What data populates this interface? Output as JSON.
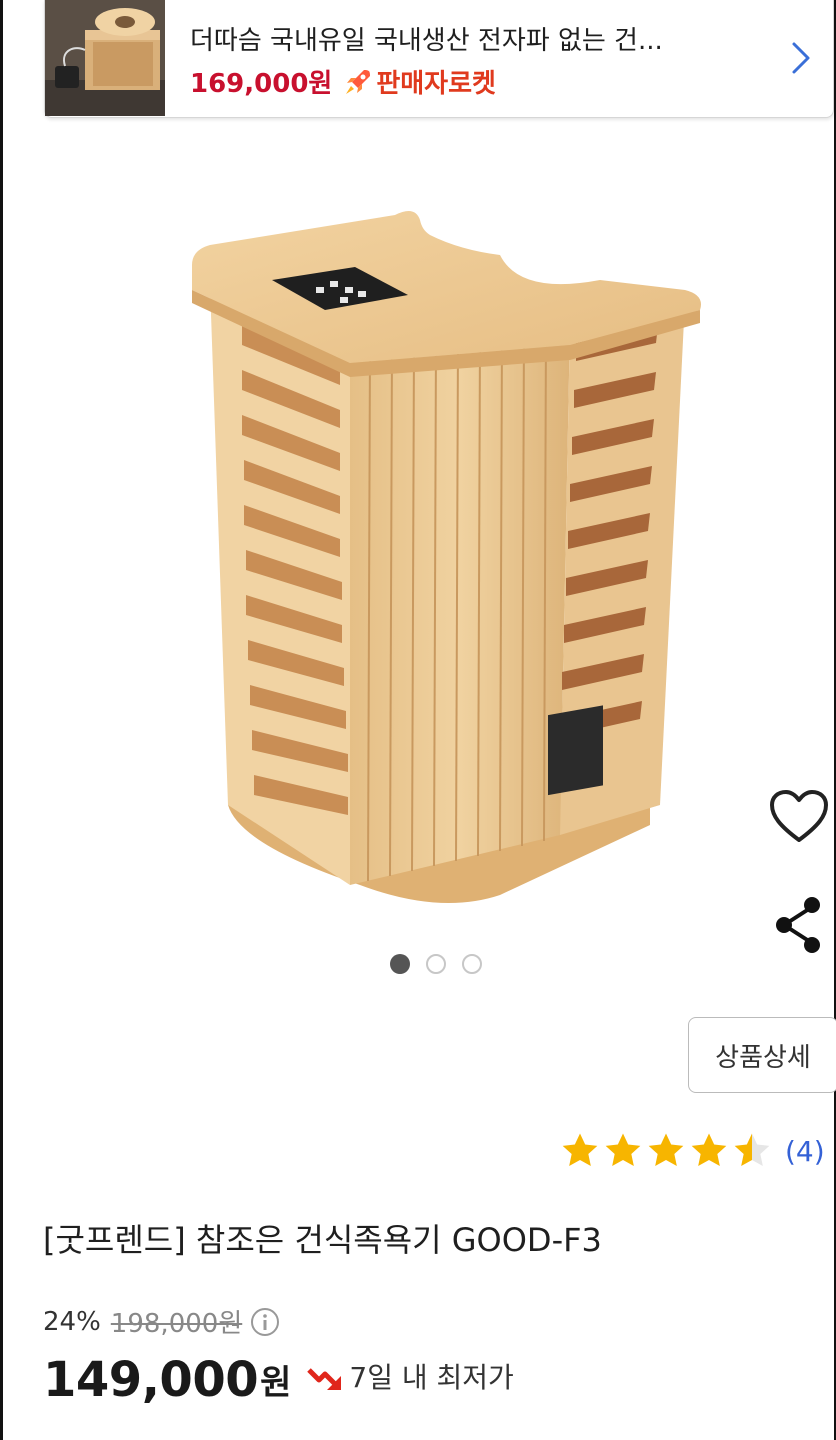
{
  "banner": {
    "title": "더따슴 국내유일 국내생산 전자파 없는 건...",
    "price": "169,000원",
    "badge_label": "판매자로켓",
    "badge_icon": "rocket-icon",
    "thumbnail_desc_icon": "foot-sauma-thumbnail"
  },
  "gallery": {
    "page_count": 3,
    "current_page": 1
  },
  "actions": {
    "favorite_icon": "heart-icon",
    "share_icon": "share-icon",
    "detail_button_label": "상품상세"
  },
  "rating": {
    "stars": 4.5,
    "review_count": "(4)"
  },
  "product": {
    "title": "[굿프렌드] 참조은 건식족욕기 GOOD-F3",
    "discount_rate": "24%",
    "original_price": "198,000원",
    "sale_price": "149,000",
    "sale_unit": "원",
    "lowest_label": "7일 내 최저가"
  },
  "colors": {
    "price_red": "#c8102e",
    "rocket_orange": "#e03a1e",
    "star_yellow": "#f7b500",
    "link_blue": "#3461d6"
  }
}
